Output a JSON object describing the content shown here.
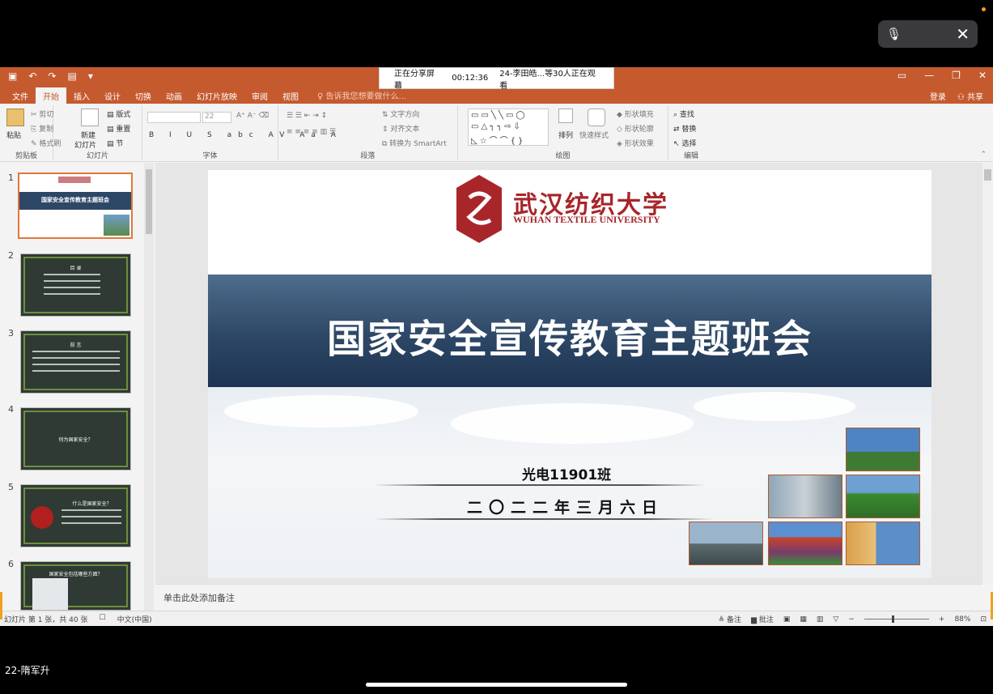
{
  "overlay": {
    "mic_icon": "microphone-icon",
    "close_icon": "close-icon",
    "caller_name": "22-隋军升"
  },
  "share_banner": {
    "status": "正在分享屏幕",
    "elapsed": "00:12:36",
    "viewers": "24-李田皓...等30人正在观看"
  },
  "titlebar": {
    "qat": [
      "save-icon",
      "undo-icon",
      "redo-icon",
      "present-icon"
    ]
  },
  "tabs": [
    {
      "label": "文件"
    },
    {
      "label": "开始"
    },
    {
      "label": "插入"
    },
    {
      "label": "设计"
    },
    {
      "label": "切换"
    },
    {
      "label": "动画"
    },
    {
      "label": "幻灯片放映"
    },
    {
      "label": "审阅"
    },
    {
      "label": "视图"
    }
  ],
  "tellme": "告诉我您想要做什么...",
  "account": {
    "login": "登录",
    "share": "共享"
  },
  "ribbon": {
    "clipboard": {
      "paste": "粘贴",
      "cut": "剪切",
      "copy": "复制",
      "format_painter": "格式刷",
      "label": "剪贴板"
    },
    "slides": {
      "new_slide": "新建",
      "new_slide2": "幻灯片",
      "layout": "版式",
      "reset": "重置",
      "section": "节",
      "label": "幻灯片"
    },
    "font": {
      "font_size": "22",
      "label": "字体",
      "buttons": [
        "B",
        "I",
        "U",
        "S",
        "abc",
        "AV",
        "Aa",
        "A"
      ]
    },
    "paragraph": {
      "text_direction": "文字方向",
      "align_text": "对齐文本",
      "smartart": "转换为 SmartArt",
      "label": "段落"
    },
    "drawing": {
      "arrange": "排列",
      "quick_styles": "快速样式",
      "shape_fill": "形状填充",
      "shape_outline": "形状轮廓",
      "shape_effects": "形状效果",
      "label": "绘图"
    },
    "editing": {
      "find": "查找",
      "replace": "替换",
      "select": "选择",
      "label": "编辑"
    }
  },
  "thumbnails": [
    {
      "num": "1",
      "title": "国家安全宣传教育主题班会"
    },
    {
      "num": "2",
      "title": "目 录"
    },
    {
      "num": "3",
      "title": "前 言"
    },
    {
      "num": "4",
      "title": "何为国家安全？"
    },
    {
      "num": "5",
      "title": "什么是国家安全？"
    },
    {
      "num": "6",
      "title": "国家安全包括哪些方面？"
    }
  ],
  "slide": {
    "university_cn": "武汉纺织大学",
    "university_en": "WUHAN TEXTILE UNIVERSITY",
    "title": "国家安全宣传教育主题班会",
    "class_name": "光电11901班",
    "date": "二〇二二年三月六日"
  },
  "notes_placeholder": "单击此处添加备注",
  "status": {
    "slide_info": "幻灯片 第 1 张，共 40 张",
    "language": "中文(中国)",
    "notes_btn": "备注",
    "comments_btn": "批注",
    "zoom": "88%"
  },
  "colors": {
    "accent": "#c55a2e",
    "banner": "#2d4766",
    "logo_red": "#a8262a"
  }
}
